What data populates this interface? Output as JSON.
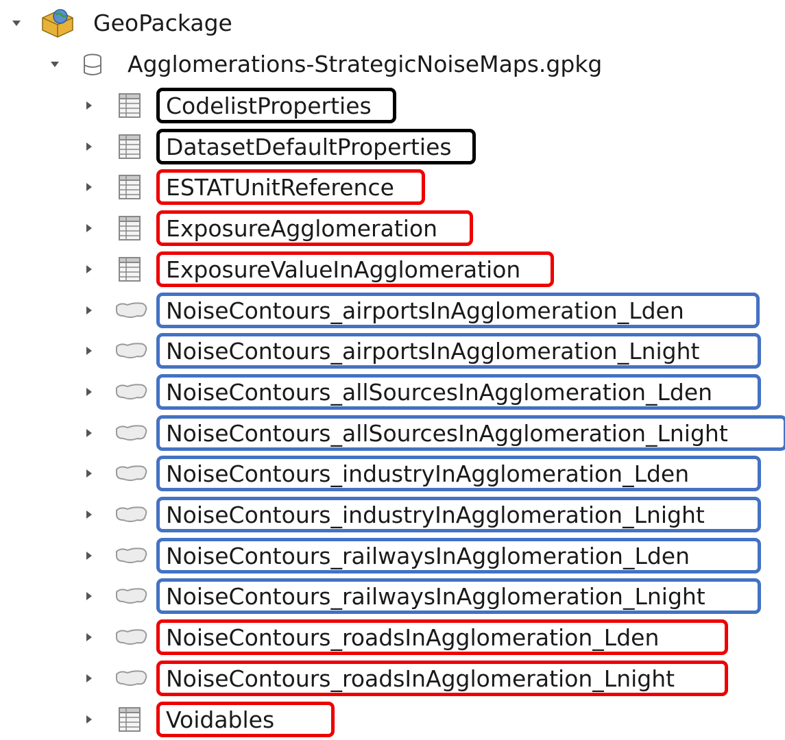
{
  "tree": {
    "root": {
      "label": "GeoPackage",
      "icon": "geopackage-icon",
      "expanded": true
    },
    "database": {
      "label": "Agglomerations-StrategicNoiseMaps.gpkg",
      "icon": "database-icon",
      "expanded": true
    },
    "children": [
      {
        "label": "CodelistProperties",
        "icon": "table-icon",
        "highlight": "#000000"
      },
      {
        "label": "DatasetDefaultProperties",
        "icon": "table-icon",
        "highlight": "#000000"
      },
      {
        "label": "ESTATUnitReference",
        "icon": "table-icon",
        "highlight": "#ee0000"
      },
      {
        "label": "ExposureAgglomeration",
        "icon": "table-icon",
        "highlight": "#ee0000"
      },
      {
        "label": "ExposureValueInAgglomeration",
        "icon": "table-icon",
        "highlight": "#ee0000"
      },
      {
        "label": "NoiseContours_airportsInAgglomeration_Lden",
        "icon": "polygon-feature-class-icon",
        "highlight": "#4472c4"
      },
      {
        "label": "NoiseContours_airportsInAgglomeration_Lnight",
        "icon": "polygon-feature-class-icon",
        "highlight": "#4472c4"
      },
      {
        "label": "NoiseContours_allSourcesInAgglomeration_Lden",
        "icon": "polygon-feature-class-icon",
        "highlight": "#4472c4"
      },
      {
        "label": "NoiseContours_allSourcesInAgglomeration_Lnight",
        "icon": "polygon-feature-class-icon",
        "highlight": "#4472c4"
      },
      {
        "label": "NoiseContours_industryInAgglomeration_Lden",
        "icon": "polygon-feature-class-icon",
        "highlight": "#4472c4"
      },
      {
        "label": "NoiseContours_industryInAgglomeration_Lnight",
        "icon": "polygon-feature-class-icon",
        "highlight": "#4472c4"
      },
      {
        "label": "NoiseContours_railwaysInAgglomeration_Lden",
        "icon": "polygon-feature-class-icon",
        "highlight": "#4472c4"
      },
      {
        "label": "NoiseContours_railwaysInAgglomeration_Lnight",
        "icon": "polygon-feature-class-icon",
        "highlight": "#4472c4"
      },
      {
        "label": "NoiseContours_roadsInAgglomeration_Lden",
        "icon": "polygon-feature-class-icon",
        "highlight": "#ee0000"
      },
      {
        "label": "NoiseContours_roadsInAgglomeration_Lnight",
        "icon": "polygon-feature-class-icon",
        "highlight": "#ee0000"
      },
      {
        "label": "Voidables",
        "icon": "table-icon",
        "highlight": "#ee0000"
      }
    ]
  }
}
